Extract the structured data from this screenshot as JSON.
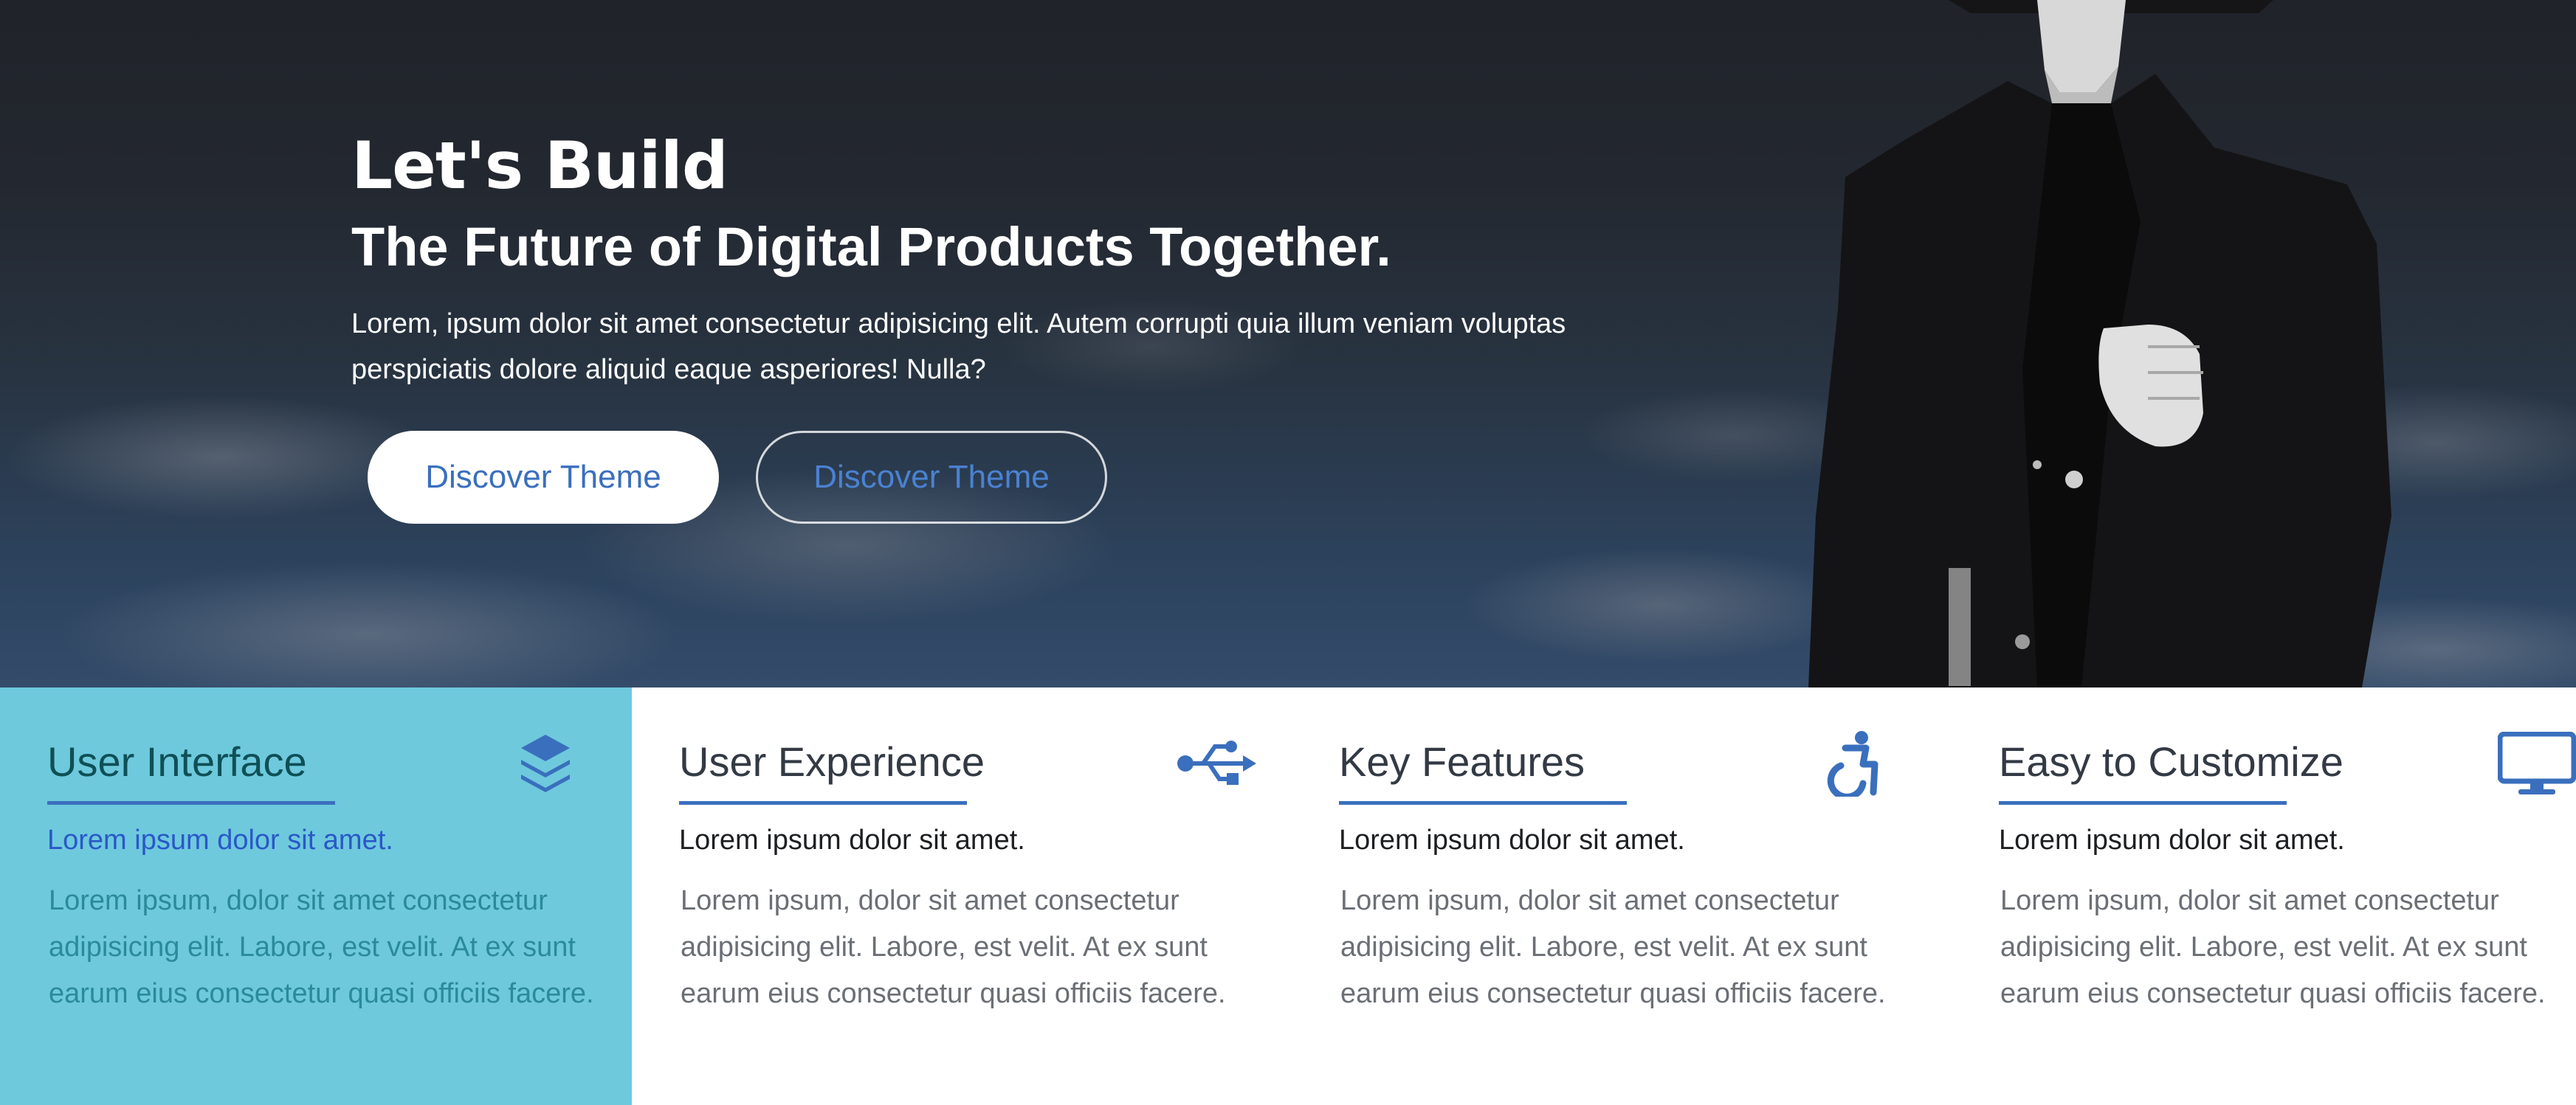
{
  "hero": {
    "title": "Let's Build",
    "subtitle": "The Future of Digital Products Together.",
    "text": "Lorem, ipsum dolor sit amet consectetur adipisicing elit. Autem corrupti quia illum veniam voluptas perspiciatis dolore aliquid eaque asperiores! Nulla?",
    "primary_button": "Discover Theme",
    "secondary_button": "Discover Theme"
  },
  "features": [
    {
      "title": "User Interface",
      "icon": "layers-icon",
      "subtitle": "Lorem ipsum dolor sit amet.",
      "body": "Lorem ipsum, dolor sit amet consectetur adipisicing elit. Labore, est velit. At ex sunt earum eius consectetur quasi officiis facere."
    },
    {
      "title": "User Experience",
      "icon": "usb-icon",
      "subtitle": "Lorem ipsum dolor sit amet.",
      "body": "Lorem ipsum, dolor sit amet consectetur adipisicing elit. Labore, est velit. At ex sunt earum eius consectetur quasi officiis facere."
    },
    {
      "title": "Key Features",
      "icon": "accessibility-icon",
      "subtitle": "Lorem ipsum dolor sit amet.",
      "body": "Lorem ipsum, dolor sit amet consectetur adipisicing elit. Labore, est velit. At ex sunt earum eius consectetur quasi officiis facere."
    },
    {
      "title": "Easy to Customize",
      "icon": "desktop-icon",
      "subtitle": "Lorem ipsum dolor sit amet.",
      "body": "Lorem ipsum, dolor sit amet consectetur adipisicing elit. Labore, est velit. At ex sunt earum eius consectetur quasi officiis facere."
    }
  ],
  "colors": {
    "accent": "#3a6fbd",
    "active_panel": "#6ec9dd",
    "hero_dark": "#23272f"
  }
}
